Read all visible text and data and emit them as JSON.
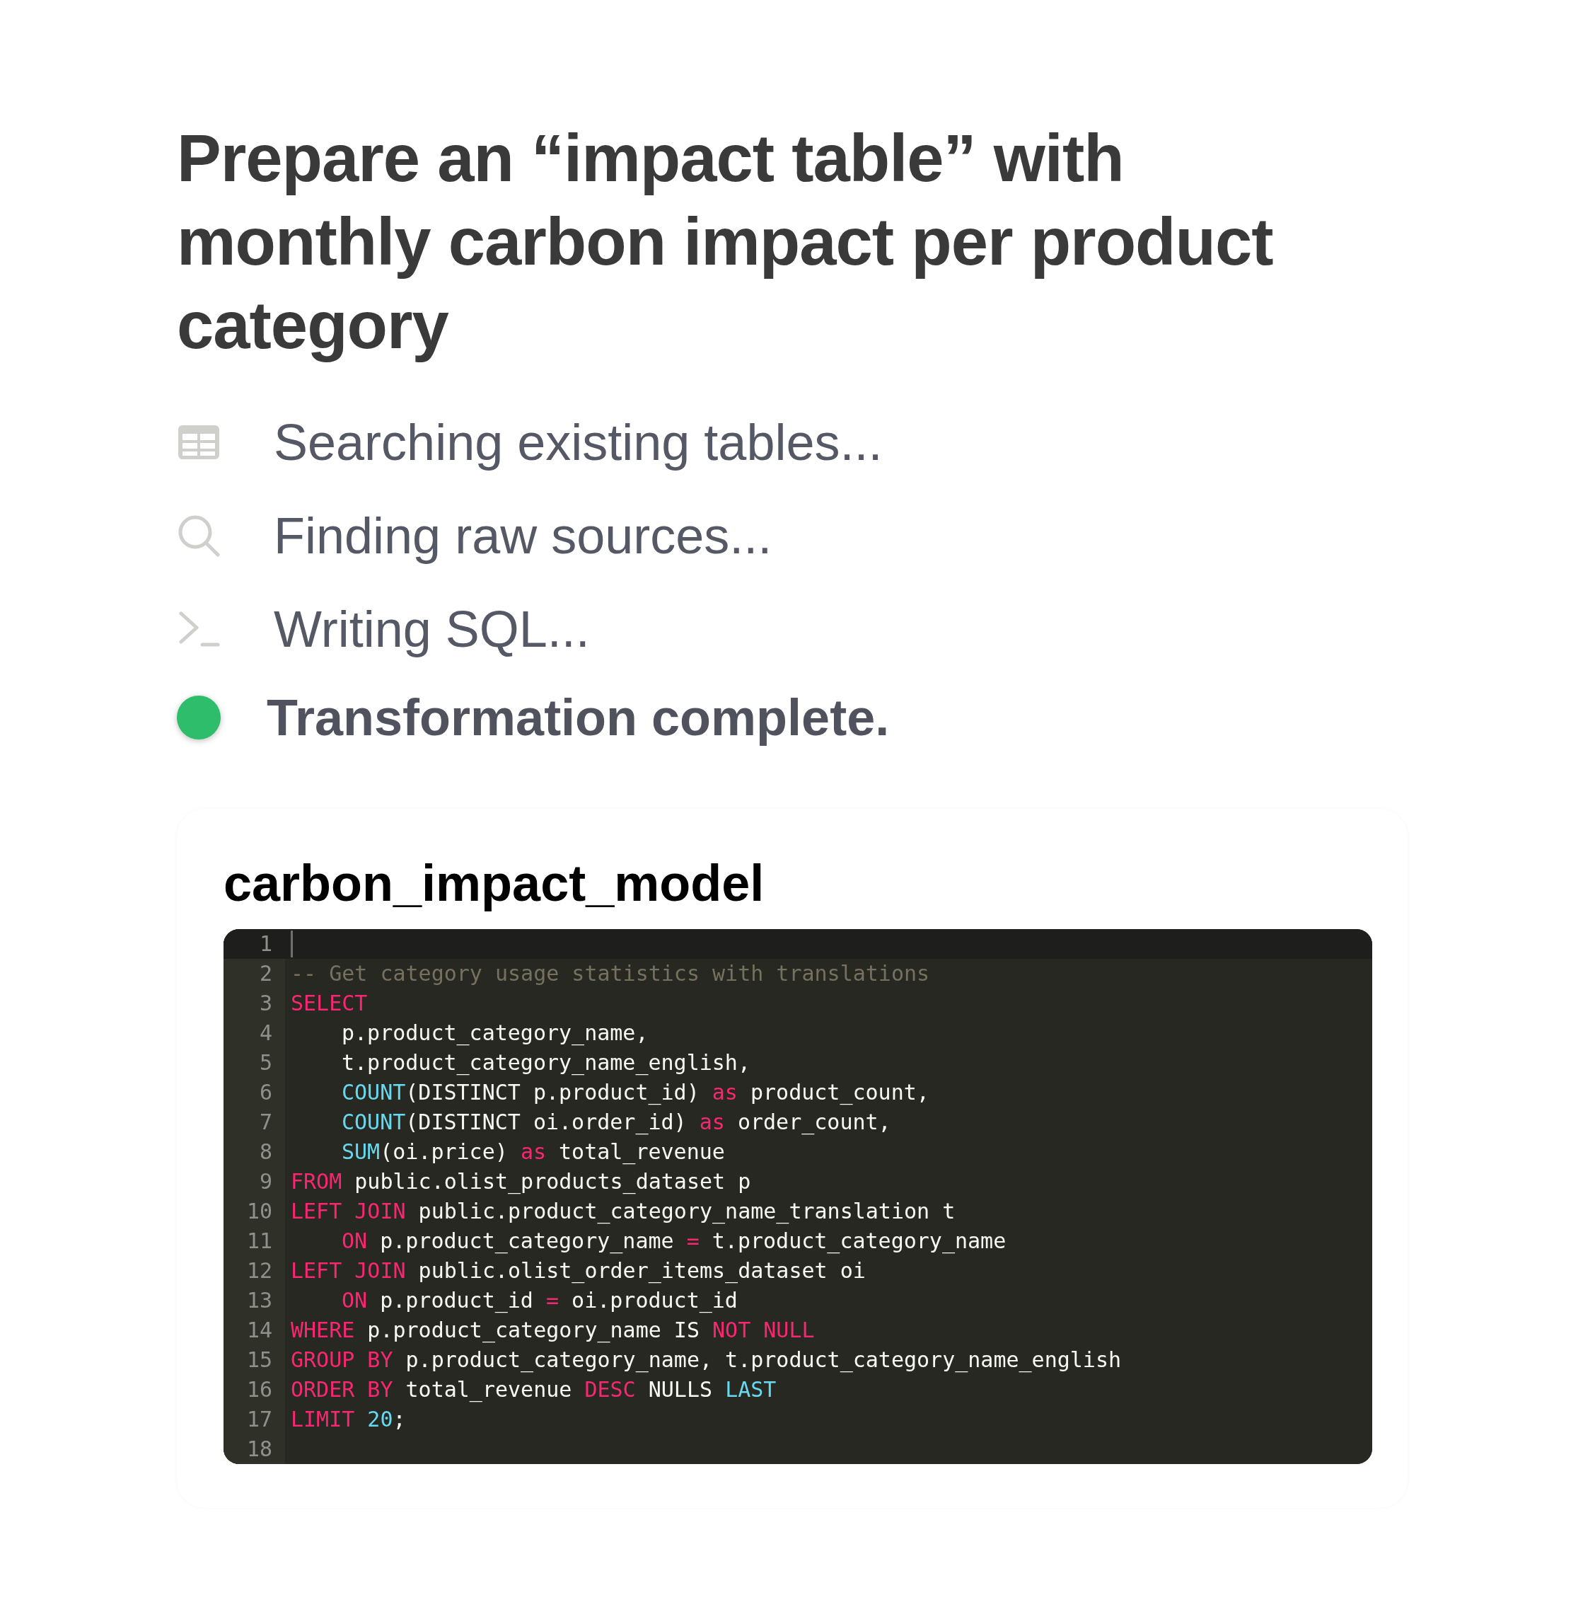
{
  "title": "Prepare an “impact table” with monthly carbon impact per product category",
  "steps": [
    {
      "kind": "table",
      "label": "Searching existing tables...",
      "done": false
    },
    {
      "kind": "search",
      "label": "Finding raw sources...",
      "done": false
    },
    {
      "kind": "terminal",
      "label": "Writing SQL...",
      "done": false
    },
    {
      "kind": "status",
      "label": "Transformation complete.",
      "done": true,
      "color": "#2ebd6b"
    }
  ],
  "model": {
    "name": "carbon_impact_model",
    "lines": [
      {
        "number": "1",
        "active": true
      },
      {
        "number": "2",
        "active": false,
        "indented": false,
        "tokens": [
          {
            "kind": "comment",
            "text": "-- Get category usage statistics with translations"
          }
        ]
      },
      {
        "number": "3",
        "active": false,
        "indented": false,
        "tokens": [
          {
            "kind": "keyword",
            "text": "SELECT"
          }
        ]
      },
      {
        "number": "4",
        "active": false,
        "indented": true,
        "tokens": [
          {
            "kind": "plain",
            "text": "p.product_category_name,"
          }
        ]
      },
      {
        "number": "5",
        "active": false,
        "indented": true,
        "tokens": [
          {
            "kind": "plain",
            "text": "t.product_category_name_english,"
          }
        ]
      },
      {
        "number": "6",
        "active": false,
        "indented": true,
        "tokens": [
          {
            "kind": "function",
            "text": "COUNT"
          },
          {
            "kind": "plain",
            "text": "(DISTINCT p.product_id) "
          },
          {
            "kind": "keyword",
            "text": "as"
          },
          {
            "kind": "plain",
            "text": " product_count,"
          }
        ]
      },
      {
        "number": "7",
        "active": false,
        "indented": true,
        "tokens": [
          {
            "kind": "function",
            "text": "COUNT"
          },
          {
            "kind": "plain",
            "text": "(DISTINCT oi.order_id) "
          },
          {
            "kind": "keyword",
            "text": "as"
          },
          {
            "kind": "plain",
            "text": " order_count,"
          }
        ]
      },
      {
        "number": "8",
        "active": false,
        "indented": true,
        "tokens": [
          {
            "kind": "function",
            "text": "SUM"
          },
          {
            "kind": "plain",
            "text": "(oi.price) "
          },
          {
            "kind": "keyword",
            "text": "as"
          },
          {
            "kind": "plain",
            "text": " total_revenue"
          }
        ]
      },
      {
        "number": "9",
        "active": false,
        "indented": false,
        "tokens": [
          {
            "kind": "keyword",
            "text": "FROM"
          },
          {
            "kind": "plain",
            "text": " public.olist_products_dataset p"
          }
        ]
      },
      {
        "number": "10",
        "active": false,
        "indented": false,
        "tokens": [
          {
            "kind": "keyword",
            "text": "LEFT JOIN"
          },
          {
            "kind": "plain",
            "text": " public.product_category_name_translation t"
          }
        ]
      },
      {
        "number": "11",
        "active": false,
        "indented": true,
        "tokens": [
          {
            "kind": "keyword",
            "text": "ON"
          },
          {
            "kind": "plain",
            "text": " p.product_category_name "
          },
          {
            "kind": "keyword",
            "text": "="
          },
          {
            "kind": "plain",
            "text": " t.product_category_name"
          }
        ]
      },
      {
        "number": "12",
        "active": false,
        "indented": false,
        "tokens": [
          {
            "kind": "keyword",
            "text": "LEFT JOIN"
          },
          {
            "kind": "plain",
            "text": " public.olist_order_items_dataset oi"
          }
        ]
      },
      {
        "number": "13",
        "active": false,
        "indented": true,
        "tokens": [
          {
            "kind": "keyword",
            "text": "ON"
          },
          {
            "kind": "plain",
            "text": " p.product_id "
          },
          {
            "kind": "keyword",
            "text": "="
          },
          {
            "kind": "plain",
            "text": " oi.product_id"
          }
        ]
      },
      {
        "number": "14",
        "active": false,
        "indented": false,
        "tokens": [
          {
            "kind": "keyword",
            "text": "WHERE"
          },
          {
            "kind": "plain",
            "text": " p.product_category_name IS "
          },
          {
            "kind": "keyword",
            "text": "NOT NULL"
          }
        ]
      },
      {
        "number": "15",
        "active": false,
        "indented": false,
        "tokens": [
          {
            "kind": "keyword",
            "text": "GROUP BY"
          },
          {
            "kind": "plain",
            "text": " p.product_category_name, t.product_category_name_english"
          }
        ]
      },
      {
        "number": "16",
        "active": false,
        "indented": false,
        "tokens": [
          {
            "kind": "keyword",
            "text": "ORDER BY"
          },
          {
            "kind": "plain",
            "text": " total_revenue "
          },
          {
            "kind": "keyword",
            "text": "DESC"
          },
          {
            "kind": "plain",
            "text": " NULLS "
          },
          {
            "kind": "function",
            "text": "LAST"
          }
        ]
      },
      {
        "number": "17",
        "active": false,
        "indented": false,
        "tokens": [
          {
            "kind": "keyword",
            "text": "LIMIT"
          },
          {
            "kind": "function",
            "text": " 20"
          },
          {
            "kind": "plain",
            "text": ";"
          }
        ]
      },
      {
        "number": "18",
        "active": false
      }
    ]
  }
}
